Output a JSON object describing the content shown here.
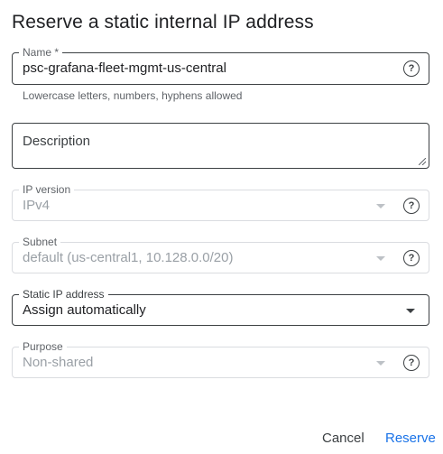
{
  "dialog": {
    "title": "Reserve a static internal IP address"
  },
  "fields": {
    "name": {
      "label": "Name *",
      "value": "psc-grafana-fleet-mgmt-us-central",
      "hint": "Lowercase letters, numbers, hyphens allowed"
    },
    "description": {
      "label": "Description",
      "value": ""
    },
    "ip_version": {
      "label": "IP version",
      "value": "IPv4"
    },
    "subnet": {
      "label": "Subnet",
      "value": "default (us-central1, 10.128.0.0/20)"
    },
    "static_ip": {
      "label": "Static IP address",
      "value": "Assign automatically"
    },
    "purpose": {
      "label": "Purpose",
      "value": "Non-shared"
    }
  },
  "actions": {
    "cancel_label": "Cancel",
    "reserve_label": "Reserve"
  },
  "colors": {
    "accent": "#1a73e8",
    "text": "#202124",
    "disabled_text": "#9aa0a6"
  },
  "icons": {
    "help": "help-circle-icon",
    "dropdown": "caret-down-icon"
  }
}
